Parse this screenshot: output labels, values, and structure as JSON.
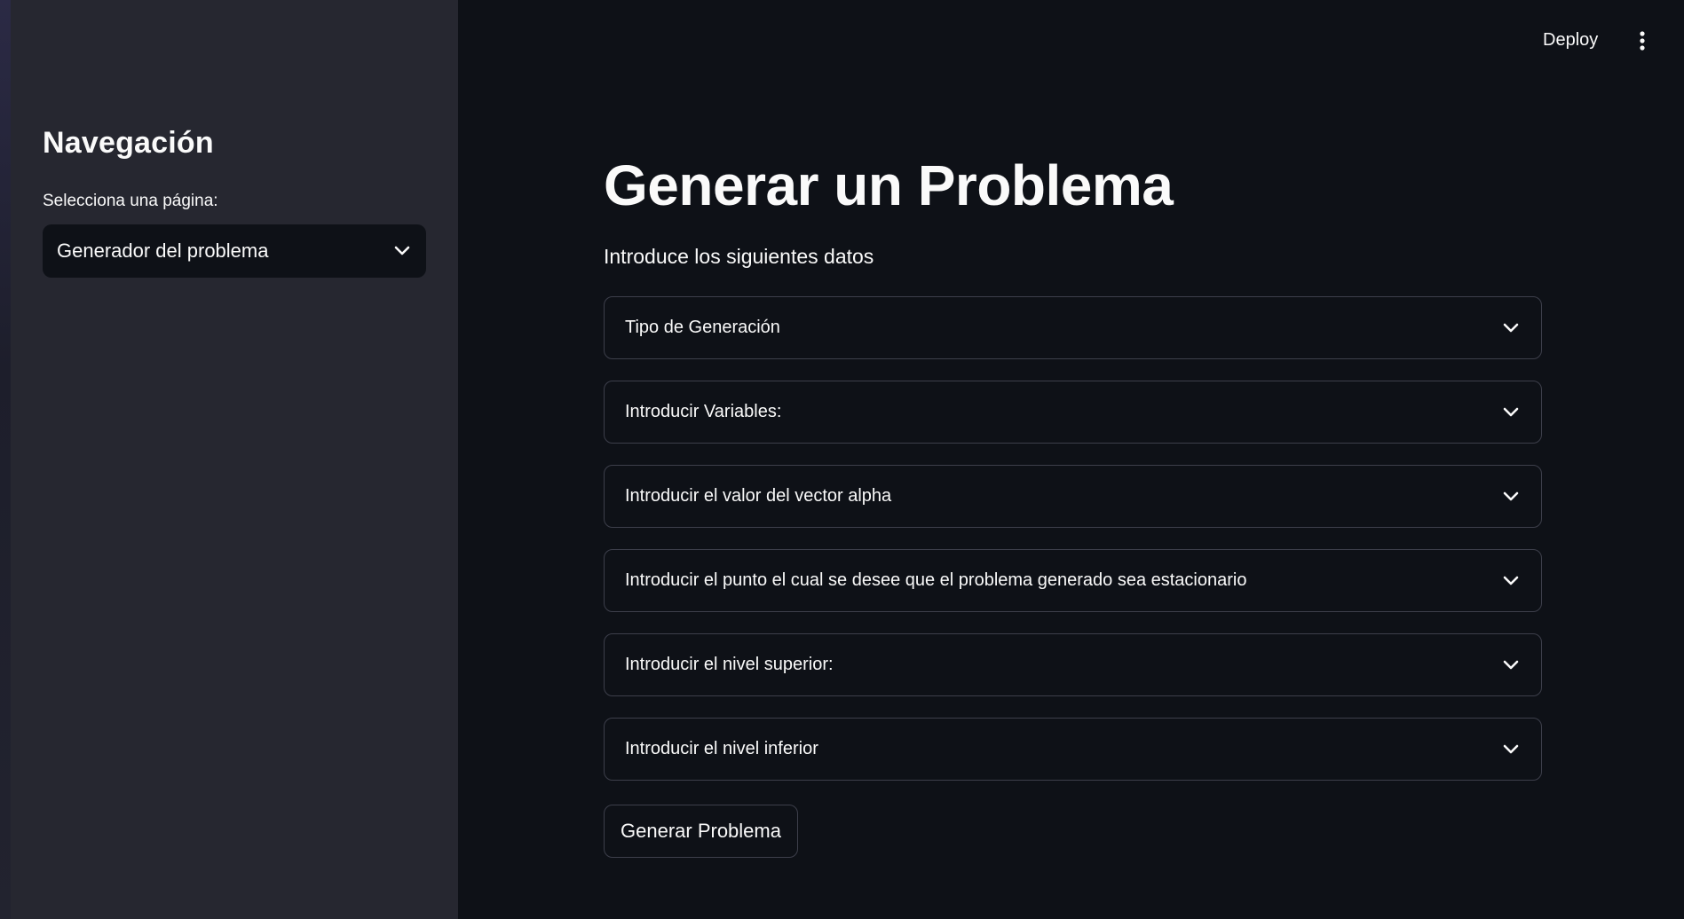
{
  "header": {
    "deploy_label": "Deploy",
    "menu_icon": "vertical-dots-icon"
  },
  "sidebar": {
    "title": "Navegación",
    "select_label": "Selecciona una página:",
    "select_value": "Generador del problema",
    "select_icon": "chevron-down-icon"
  },
  "main": {
    "title": "Generar un Problema",
    "subtitle": "Introduce los siguientes datos",
    "expanders": [
      {
        "label": "Tipo de Generación"
      },
      {
        "label": "Introducir Variables:"
      },
      {
        "label": "Introducir el valor del vector alpha"
      },
      {
        "label": "Introducir el punto el cual se desee que el problema generado sea estacionario"
      },
      {
        "label": "Introducir el nivel superior:"
      },
      {
        "label": "Introducir el nivel inferior"
      }
    ],
    "generate_button_label": "Generar Problema"
  },
  "colors": {
    "background": "#0e1117",
    "sidebar": "#262730",
    "border": "#3d3f4b",
    "text": "#fafafa"
  }
}
